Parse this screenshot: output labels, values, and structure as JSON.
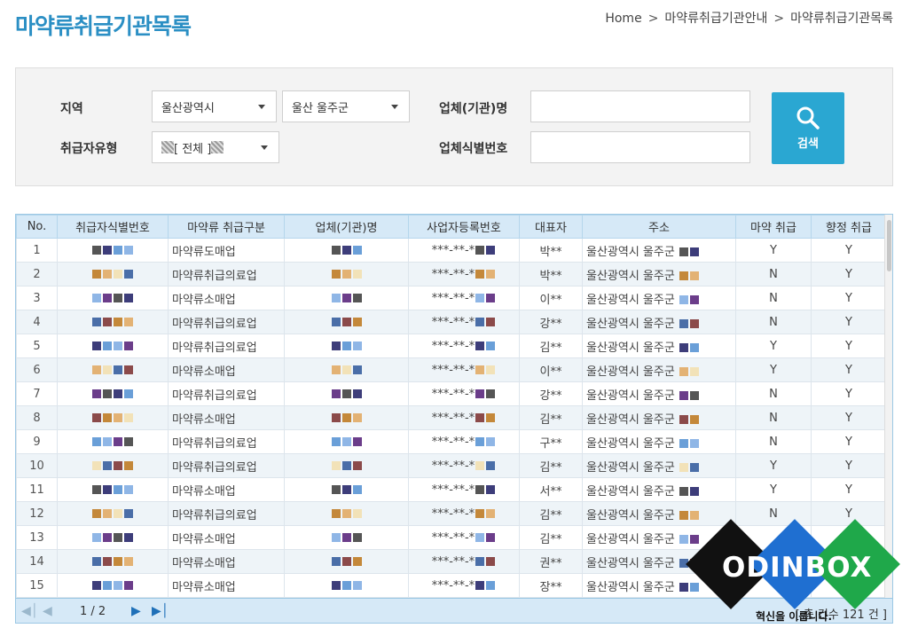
{
  "page_title": "마약류취급기관목록",
  "breadcrumb": [
    "Home",
    "마약류취급기관안내",
    "마약류취급기관목록"
  ],
  "breadcrumb_sep": ">",
  "search": {
    "region_label": "지역",
    "region_city": "울산광역시",
    "region_district": "울산 울주군",
    "handler_type_label": "취급자유형",
    "handler_type_value": "[ 전체 ]",
    "company_label": "업체(기관)명",
    "company_id_label": "업체식별번호",
    "button_label": "검색",
    "button_icon": "search-icon"
  },
  "table": {
    "headers": [
      "No.",
      "취급자식별번호",
      "마약류 취급구분",
      "업체(기관)명",
      "사업자등록번호",
      "대표자",
      "주소",
      "마약 취급",
      "향정 취급"
    ],
    "rows": [
      {
        "no": "1",
        "type": "마약류도매업",
        "reg": "***-**-*",
        "rep": "박**",
        "addr": "울산광역시 울주군",
        "narc": "Y",
        "psy": "Y"
      },
      {
        "no": "2",
        "type": "마약류취급의료업",
        "reg": "***-**-*",
        "rep": "박**",
        "addr": "울산광역시 울주군",
        "narc": "N",
        "psy": "Y"
      },
      {
        "no": "3",
        "type": "마약류소매업",
        "reg": "***-**-*",
        "rep": "이**",
        "addr": "울산광역시 울주군",
        "narc": "N",
        "psy": "Y"
      },
      {
        "no": "4",
        "type": "마약류취급의료업",
        "reg": "***-**-*",
        "rep": "강**",
        "addr": "울산광역시 울주군",
        "narc": "N",
        "psy": "Y"
      },
      {
        "no": "5",
        "type": "마약류취급의료업",
        "reg": "***-**-*",
        "rep": "김**",
        "addr": "울산광역시 울주군",
        "narc": "Y",
        "psy": "Y"
      },
      {
        "no": "6",
        "type": "마약류소매업",
        "reg": "***-**-*",
        "rep": "이**",
        "addr": "울산광역시 울주군",
        "narc": "Y",
        "psy": "Y"
      },
      {
        "no": "7",
        "type": "마약류취급의료업",
        "reg": "***-**-*",
        "rep": "강**",
        "addr": "울산광역시 울주군",
        "narc": "N",
        "psy": "Y"
      },
      {
        "no": "8",
        "type": "마약류소매업",
        "reg": "***-**-*",
        "rep": "김**",
        "addr": "울산광역시 울주군",
        "narc": "N",
        "psy": "Y"
      },
      {
        "no": "9",
        "type": "마약류취급의료업",
        "reg": "***-**-*",
        "rep": "구**",
        "addr": "울산광역시 울주군",
        "narc": "N",
        "psy": "Y"
      },
      {
        "no": "10",
        "type": "마약류취급의료업",
        "reg": "***-**-*",
        "rep": "김**",
        "addr": "울산광역시 울주군",
        "narc": "Y",
        "psy": "Y"
      },
      {
        "no": "11",
        "type": "마약류소매업",
        "reg": "***-**-*",
        "rep": "서**",
        "addr": "울산광역시 울주군",
        "narc": "Y",
        "psy": "Y"
      },
      {
        "no": "12",
        "type": "마약류취급의료업",
        "reg": "***-**-*",
        "rep": "김**",
        "addr": "울산광역시 울주군",
        "narc": "N",
        "psy": "Y"
      },
      {
        "no": "13",
        "type": "마약류소매업",
        "reg": "***-**-*",
        "rep": "김**",
        "addr": "울산광역시 울주군",
        "narc": "",
        "psy": ""
      },
      {
        "no": "14",
        "type": "마약류소매업",
        "reg": "***-**-*",
        "rep": "권**",
        "addr": "울산광역시 울주군",
        "narc": "",
        "psy": ""
      },
      {
        "no": "15",
        "type": "마약류소매업",
        "reg": "***-**-*",
        "rep": "장**",
        "addr": "울산광역시 울주군",
        "narc": "",
        "psy": ""
      }
    ]
  },
  "pager": {
    "page_text": "1 / 2",
    "total_text": "[ 총 건수 121 건 ]"
  },
  "watermark": {
    "brand": "ODINBOX",
    "tagline": "혁신을 이룹니다."
  },
  "colors": {
    "title": "#2b8fc4",
    "search_button": "#2aa7d2",
    "header_bg": "#d6e9f7",
    "alt_row": "#eef4f8"
  }
}
